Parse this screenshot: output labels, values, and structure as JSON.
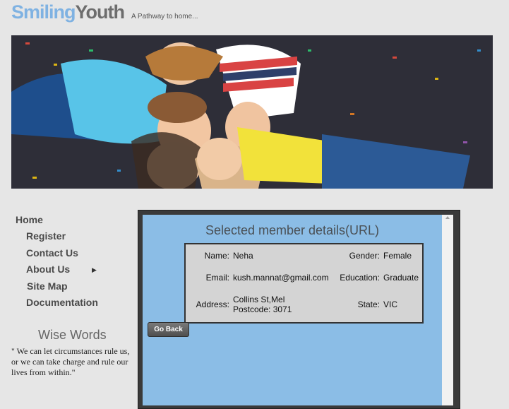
{
  "logo": {
    "part1": "Smiling",
    "part2": "Youth"
  },
  "tagline": "A Pathway to home...",
  "nav": {
    "home": "Home",
    "register": "Register",
    "contact": "Contact Us",
    "about": "About Us",
    "sitemap": "Site Map",
    "documentation": "Documentation"
  },
  "wise": {
    "title": "Wise Words",
    "quote": "\" We can let circumstances rule us, or we can take charge and rule our lives from within.\""
  },
  "panel": {
    "title": "Selected member details(URL)",
    "name_label": "Name:",
    "name": "Neha",
    "gender_label": "Gender:",
    "gender": "Female",
    "email_label": "Email:",
    "email": "kush.mannat@gmail.com",
    "education_label": "Education:",
    "education": "Graduate",
    "address_label": "Address:",
    "address_line1": "Collins St,Mel",
    "address_line2": "Postcode: 3071",
    "state_label": "State:",
    "state": "VIC",
    "back_label": "Go Back"
  },
  "colors": {
    "panel_bg": "#8bbde6",
    "logo_blue": "#7fb2e2",
    "logo_grey": "#6d6d6d"
  }
}
